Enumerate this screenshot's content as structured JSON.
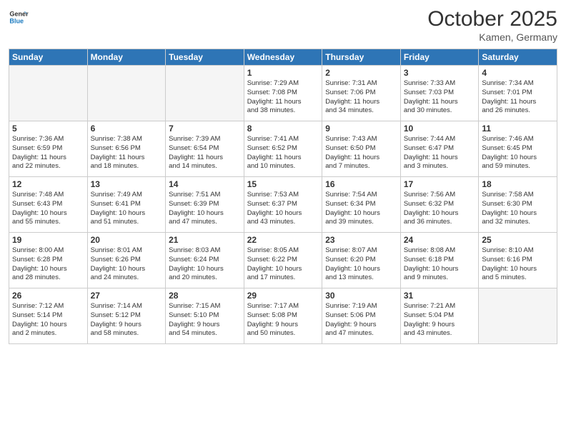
{
  "logo": {
    "line1": "General",
    "line2": "Blue"
  },
  "title": "October 2025",
  "location": "Kamen, Germany",
  "days_of_week": [
    "Sunday",
    "Monday",
    "Tuesday",
    "Wednesday",
    "Thursday",
    "Friday",
    "Saturday"
  ],
  "weeks": [
    [
      {
        "day": "",
        "info": ""
      },
      {
        "day": "",
        "info": ""
      },
      {
        "day": "",
        "info": ""
      },
      {
        "day": "1",
        "info": "Sunrise: 7:29 AM\nSunset: 7:08 PM\nDaylight: 11 hours\nand 38 minutes."
      },
      {
        "day": "2",
        "info": "Sunrise: 7:31 AM\nSunset: 7:06 PM\nDaylight: 11 hours\nand 34 minutes."
      },
      {
        "day": "3",
        "info": "Sunrise: 7:33 AM\nSunset: 7:03 PM\nDaylight: 11 hours\nand 30 minutes."
      },
      {
        "day": "4",
        "info": "Sunrise: 7:34 AM\nSunset: 7:01 PM\nDaylight: 11 hours\nand 26 minutes."
      }
    ],
    [
      {
        "day": "5",
        "info": "Sunrise: 7:36 AM\nSunset: 6:59 PM\nDaylight: 11 hours\nand 22 minutes."
      },
      {
        "day": "6",
        "info": "Sunrise: 7:38 AM\nSunset: 6:56 PM\nDaylight: 11 hours\nand 18 minutes."
      },
      {
        "day": "7",
        "info": "Sunrise: 7:39 AM\nSunset: 6:54 PM\nDaylight: 11 hours\nand 14 minutes."
      },
      {
        "day": "8",
        "info": "Sunrise: 7:41 AM\nSunset: 6:52 PM\nDaylight: 11 hours\nand 10 minutes."
      },
      {
        "day": "9",
        "info": "Sunrise: 7:43 AM\nSunset: 6:50 PM\nDaylight: 11 hours\nand 7 minutes."
      },
      {
        "day": "10",
        "info": "Sunrise: 7:44 AM\nSunset: 6:47 PM\nDaylight: 11 hours\nand 3 minutes."
      },
      {
        "day": "11",
        "info": "Sunrise: 7:46 AM\nSunset: 6:45 PM\nDaylight: 10 hours\nand 59 minutes."
      }
    ],
    [
      {
        "day": "12",
        "info": "Sunrise: 7:48 AM\nSunset: 6:43 PM\nDaylight: 10 hours\nand 55 minutes."
      },
      {
        "day": "13",
        "info": "Sunrise: 7:49 AM\nSunset: 6:41 PM\nDaylight: 10 hours\nand 51 minutes."
      },
      {
        "day": "14",
        "info": "Sunrise: 7:51 AM\nSunset: 6:39 PM\nDaylight: 10 hours\nand 47 minutes."
      },
      {
        "day": "15",
        "info": "Sunrise: 7:53 AM\nSunset: 6:37 PM\nDaylight: 10 hours\nand 43 minutes."
      },
      {
        "day": "16",
        "info": "Sunrise: 7:54 AM\nSunset: 6:34 PM\nDaylight: 10 hours\nand 39 minutes."
      },
      {
        "day": "17",
        "info": "Sunrise: 7:56 AM\nSunset: 6:32 PM\nDaylight: 10 hours\nand 36 minutes."
      },
      {
        "day": "18",
        "info": "Sunrise: 7:58 AM\nSunset: 6:30 PM\nDaylight: 10 hours\nand 32 minutes."
      }
    ],
    [
      {
        "day": "19",
        "info": "Sunrise: 8:00 AM\nSunset: 6:28 PM\nDaylight: 10 hours\nand 28 minutes."
      },
      {
        "day": "20",
        "info": "Sunrise: 8:01 AM\nSunset: 6:26 PM\nDaylight: 10 hours\nand 24 minutes."
      },
      {
        "day": "21",
        "info": "Sunrise: 8:03 AM\nSunset: 6:24 PM\nDaylight: 10 hours\nand 20 minutes."
      },
      {
        "day": "22",
        "info": "Sunrise: 8:05 AM\nSunset: 6:22 PM\nDaylight: 10 hours\nand 17 minutes."
      },
      {
        "day": "23",
        "info": "Sunrise: 8:07 AM\nSunset: 6:20 PM\nDaylight: 10 hours\nand 13 minutes."
      },
      {
        "day": "24",
        "info": "Sunrise: 8:08 AM\nSunset: 6:18 PM\nDaylight: 10 hours\nand 9 minutes."
      },
      {
        "day": "25",
        "info": "Sunrise: 8:10 AM\nSunset: 6:16 PM\nDaylight: 10 hours\nand 5 minutes."
      }
    ],
    [
      {
        "day": "26",
        "info": "Sunrise: 7:12 AM\nSunset: 5:14 PM\nDaylight: 10 hours\nand 2 minutes."
      },
      {
        "day": "27",
        "info": "Sunrise: 7:14 AM\nSunset: 5:12 PM\nDaylight: 9 hours\nand 58 minutes."
      },
      {
        "day": "28",
        "info": "Sunrise: 7:15 AM\nSunset: 5:10 PM\nDaylight: 9 hours\nand 54 minutes."
      },
      {
        "day": "29",
        "info": "Sunrise: 7:17 AM\nSunset: 5:08 PM\nDaylight: 9 hours\nand 50 minutes."
      },
      {
        "day": "30",
        "info": "Sunrise: 7:19 AM\nSunset: 5:06 PM\nDaylight: 9 hours\nand 47 minutes."
      },
      {
        "day": "31",
        "info": "Sunrise: 7:21 AM\nSunset: 5:04 PM\nDaylight: 9 hours\nand 43 minutes."
      },
      {
        "day": "",
        "info": ""
      }
    ]
  ]
}
